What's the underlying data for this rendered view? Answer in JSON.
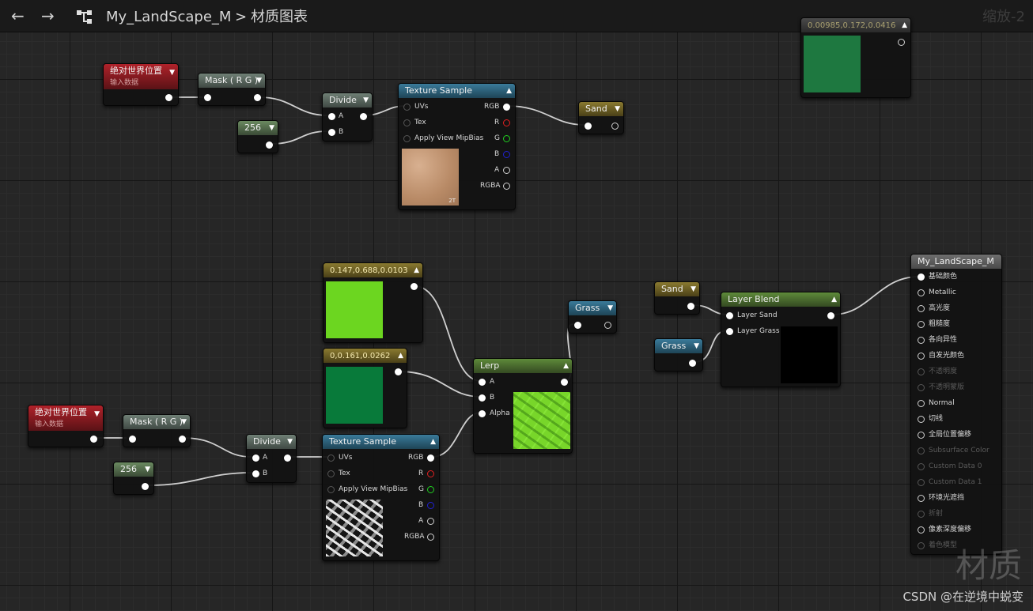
{
  "toolbar": {
    "back_icon": "←",
    "forward_icon": "→",
    "graph_icon": "graph-icon",
    "asset_name": "My_LandScape_M",
    "separator": ">",
    "section": "材质图表",
    "zoom": "缩放-2"
  },
  "nodes": {
    "abs_pos_1": {
      "title": "绝对世界位置",
      "subtitle": "输入数据"
    },
    "mask_1": {
      "title": "Mask ( R G )"
    },
    "const_256_1": {
      "title": "256"
    },
    "divide_1": {
      "title": "Divide",
      "pin_a": "A",
      "pin_b": "B"
    },
    "tex_sample_1": {
      "title": "Texture Sample",
      "in_uvs": "UVs",
      "in_tex": "Tex",
      "in_mip": "Apply View MipBias",
      "out_rgb": "RGB",
      "out_r": "R",
      "out_g": "G",
      "out_b": "B",
      "out_a": "A",
      "out_rgba": "RGBA",
      "thumb_badge": "2T"
    },
    "sand_output": {
      "title": "Sand"
    },
    "const_color_top": {
      "title": "0.00985,0.172,0.0416",
      "color": "#1e7840"
    },
    "color_lime": {
      "title": "0.147,0.688,0.0103",
      "color": "#6cd620"
    },
    "color_green": {
      "title": "0,0.161,0.0262",
      "color": "#087a3a"
    },
    "grass_node": {
      "title": "Grass"
    },
    "lerp": {
      "title": "Lerp",
      "pin_a": "A",
      "pin_b": "B",
      "pin_alpha": "Alpha"
    },
    "abs_pos_2": {
      "title": "绝对世界位置",
      "subtitle": "输入数据"
    },
    "mask_2": {
      "title": "Mask ( R G )"
    },
    "const_256_2": {
      "title": "256"
    },
    "divide_2": {
      "title": "Divide",
      "pin_a": "A",
      "pin_b": "B"
    },
    "tex_sample_2": {
      "title": "Texture Sample",
      "in_uvs": "UVs",
      "in_tex": "Tex",
      "in_mip": "Apply View MipBias",
      "out_rgb": "RGB",
      "out_r": "R",
      "out_g": "G",
      "out_b": "B",
      "out_a": "A",
      "out_rgba": "RGBA"
    },
    "sand_input": {
      "title": "Sand"
    },
    "grass_input": {
      "title": "Grass"
    },
    "layer_blend": {
      "title": "Layer Blend",
      "pin_sand": "Layer Sand",
      "pin_grass": "Layer Grass"
    },
    "material_result": {
      "title": "My_LandScape_M",
      "pins": [
        {
          "label": "基础颜色",
          "active": true,
          "connected": true
        },
        {
          "label": "Metallic",
          "active": true,
          "connected": false
        },
        {
          "label": "高光度",
          "active": true,
          "connected": false
        },
        {
          "label": "粗糙度",
          "active": true,
          "connected": false
        },
        {
          "label": "各向异性",
          "active": true,
          "connected": false
        },
        {
          "label": "自发光颜色",
          "active": true,
          "connected": false
        },
        {
          "label": "不透明度",
          "active": false,
          "connected": false
        },
        {
          "label": "不透明蒙版",
          "active": false,
          "connected": false
        },
        {
          "label": "Normal",
          "active": true,
          "connected": false
        },
        {
          "label": "切线",
          "active": true,
          "connected": false
        },
        {
          "label": "全局位置偏移",
          "active": true,
          "connected": false
        },
        {
          "label": "Subsurface Color",
          "active": false,
          "connected": false
        },
        {
          "label": "Custom Data 0",
          "active": false,
          "connected": false
        },
        {
          "label": "Custom Data 1",
          "active": false,
          "connected": false
        },
        {
          "label": "环境光遮挡",
          "active": true,
          "connected": false
        },
        {
          "label": "折射",
          "active": false,
          "connected": false
        },
        {
          "label": "像素深度偏移",
          "active": true,
          "connected": false
        },
        {
          "label": "着色模型",
          "active": false,
          "connected": false
        }
      ]
    }
  },
  "watermark": {
    "big": "材质",
    "small": "CSDN @在逆境中蜕变"
  }
}
